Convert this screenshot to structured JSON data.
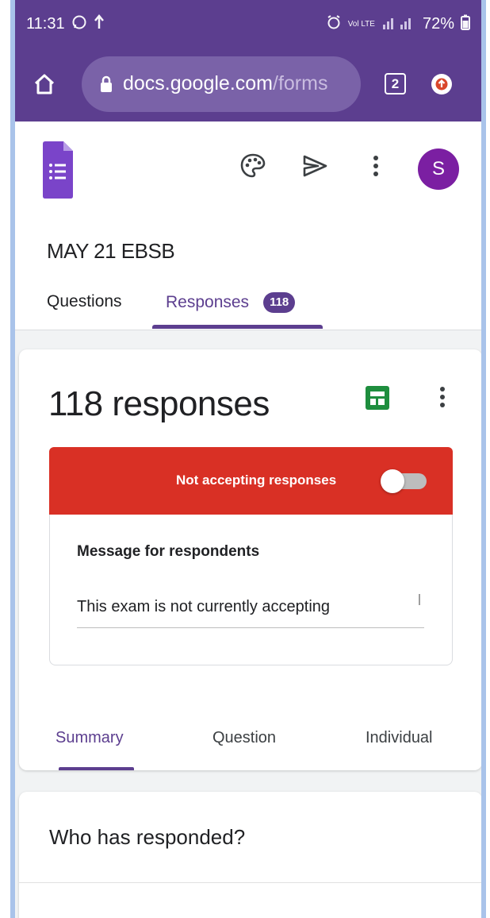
{
  "status_bar": {
    "time": "11:31",
    "indicators": "Vol LTE",
    "battery": "72%"
  },
  "browser": {
    "url_host": "docs.google.com",
    "url_path": "/forms",
    "tab_count": "2"
  },
  "form": {
    "title": "MAY 21 EBSB",
    "avatar_initial": "S",
    "tabs": {
      "questions": "Questions",
      "responses": "Responses",
      "responses_badge": "118"
    }
  },
  "responses": {
    "count_label": "118 responses",
    "banner_text": "Not accepting responses",
    "accepting": false,
    "message_label": "Message for respondents",
    "message_value": "This exam is not currently accepting",
    "subtabs": {
      "summary": "Summary",
      "question": "Question",
      "individual": "Individual"
    }
  },
  "who": {
    "title": "Who has responded?"
  },
  "colors": {
    "accent": "#5c3e8f",
    "banner": "#d93025",
    "sheets": "#1e8e3e",
    "avatar": "#7b1fa2"
  }
}
